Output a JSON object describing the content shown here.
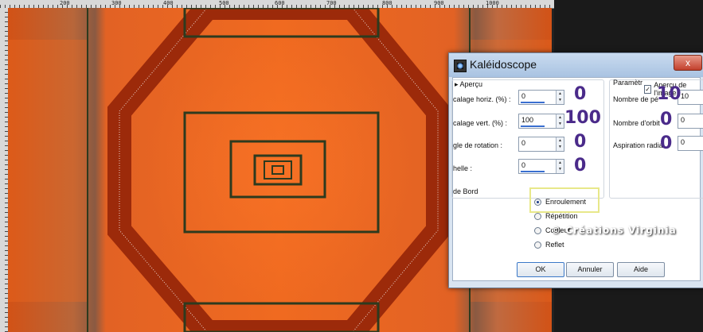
{
  "ruler": {
    "ticks": [
      "200",
      "300",
      "400",
      "500",
      "600",
      "700",
      "800",
      "900",
      "1000"
    ]
  },
  "dialog": {
    "title": "Kaléidoscope",
    "close_label": "x",
    "apercu_section": "Aperçu",
    "params_section": "Paramètr",
    "preview_check_label": "Aperçu de l'image",
    "fields": [
      {
        "label": "calage horiz. (%) :",
        "value": "0",
        "annotation": "0"
      },
      {
        "label": "calage vert. (%) :",
        "value": "100",
        "annotation": "100"
      },
      {
        "label": "gle de rotation :",
        "value": "0",
        "annotation": "0"
      },
      {
        "label": "helle :",
        "value": "0",
        "annotation": "0"
      }
    ],
    "right_fields": [
      {
        "label": "Nombre de pé",
        "value": "10",
        "annotation": "10"
      },
      {
        "label": "Nombre d'orbit",
        "value": "0",
        "annotation": "0"
      },
      {
        "label": "Aspiration radia",
        "value": "0",
        "annotation": "0"
      }
    ],
    "edge_section": "de Bord",
    "edge_options": [
      "Enroulement",
      "Répétition",
      "Couleur",
      "Reflet"
    ],
    "edge_selected": "Enroulement",
    "buttons": {
      "ok": "OK",
      "cancel": "Annuler",
      "help": "Aide"
    }
  },
  "watermark": "© Créations Virginia",
  "colors": {
    "accent_orange": "#e8541a",
    "dark_red": "#a8300c",
    "dialog_bg": "#d9e4f1",
    "annotation": "#4a2a8a"
  }
}
